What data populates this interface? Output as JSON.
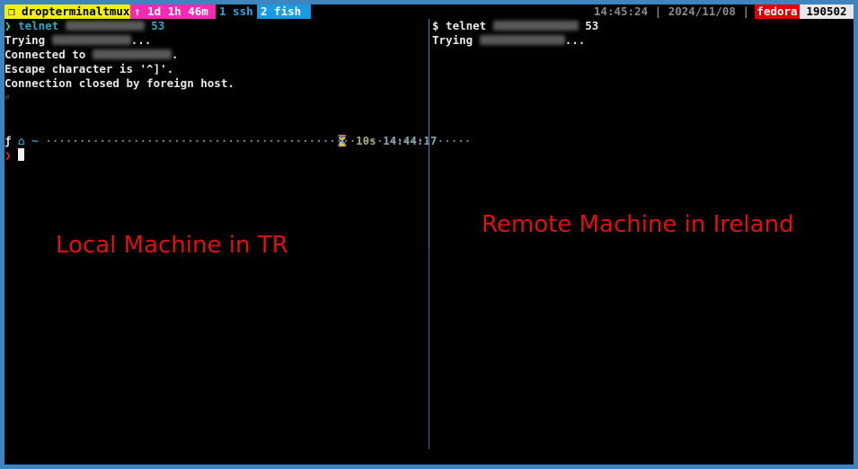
{
  "status_bar": {
    "session": "❐ dropterminaltmux",
    "uptime": "↑ 1d 1h 46m",
    "windows": [
      {
        "label": "1 ssh",
        "active": false
      },
      {
        "label": "2 fish",
        "active": true
      }
    ],
    "clock": "14:45:24 | 2024/11/08 |",
    "hostname": "fedora",
    "number": "190502"
  },
  "left_pane": {
    "prompt_cmd": "telnet",
    "port": "53",
    "trying": "Trying",
    "trying_suffix": "...",
    "connected": "Connected to",
    "connected_suffix": ".",
    "escape": "Escape character is '^]'.",
    "closed": "Connection closed by foreign host.",
    "prompt_home": "~",
    "duration": "10s",
    "time": "14:44:17",
    "annotation": "Local Machine in TR"
  },
  "right_pane": {
    "prompt_cmd": "$ telnet",
    "port": "53",
    "trying": "Trying",
    "trying_suffix": "...",
    "annotation": "Remote Machine in Ireland"
  },
  "colors": {
    "border": "#3f84be",
    "annotation": "#e01010",
    "session": "#f1f010",
    "uptime": "#f82ab4",
    "active_window": "#189be1",
    "host": "#e00000"
  }
}
